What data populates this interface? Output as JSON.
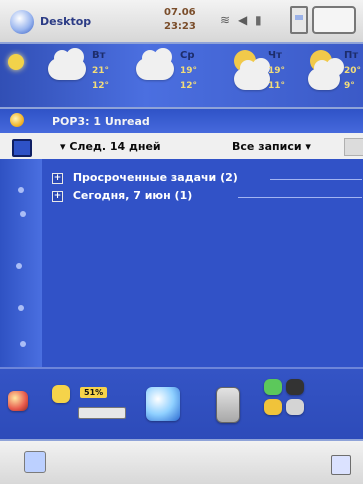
{
  "status_bar": {
    "title": "Desktop",
    "date": "07.06",
    "time": "23:23"
  },
  "weather": {
    "days": [
      {
        "name": "Вт",
        "hi": "21°",
        "lo": "12°",
        "icon": "cloud-icon"
      },
      {
        "name": "Ср",
        "hi": "19°",
        "lo": "12°",
        "icon": "cloud-icon"
      },
      {
        "name": "Чт",
        "hi": "19°",
        "lo": "11°",
        "icon": "partly-sunny-icon"
      },
      {
        "name": "Пт",
        "hi": "20°",
        "lo": "9°",
        "icon": "partly-sunny-icon"
      }
    ]
  },
  "mail": {
    "text": "POP3: 1 Unread"
  },
  "tasks_header": {
    "range": "▾ След. 14 дней",
    "filter": "Все записи ▾"
  },
  "tasks": [
    {
      "text": "Просроченные задачи (2)"
    },
    {
      "text": "Сегодня, 7 июн (1)"
    }
  ],
  "launcher": {
    "battery_percent_label": "51%"
  }
}
